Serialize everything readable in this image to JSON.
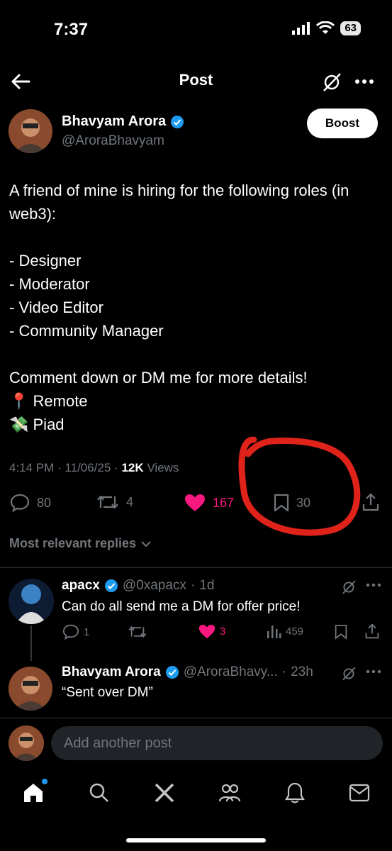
{
  "status_bar": {
    "time": "7:37",
    "battery": "63"
  },
  "header": {
    "title": "Post"
  },
  "post": {
    "author_name": "Bhavyam Arora",
    "author_handle": "@AroraBhavyam",
    "boost_label": "Boost",
    "body": "A friend of mine is hiring for the following roles (in web3):\n\n- Designer\n- Moderator\n- Video Editor\n- Community Manager\n\nComment down or DM me for more details!\n📍 Remote\n💸 Piad",
    "time": "4:14 PM",
    "date": "11/06/25",
    "views_count": "12K",
    "views_label": "Views",
    "replies": "80",
    "reposts": "4",
    "likes": "167",
    "bookmarks": "30"
  },
  "sort_label": "Most relevant replies",
  "replies": [
    {
      "name": "apacx",
      "handle": "@0xapacx",
      "age": "1d",
      "text": "Can do all send me a DM for offer price!",
      "reply_count": "1",
      "likes": "3",
      "views": "459"
    },
    {
      "name": "Bhavyam Arora",
      "handle": "@AroraBhavy...",
      "age": "23h",
      "text": "“Sent over DM”"
    }
  ],
  "composer": {
    "placeholder": "Add another post"
  },
  "colors": {
    "like": "#f91880",
    "verified": "#1d9bf0",
    "annotation": "#e0231a"
  }
}
